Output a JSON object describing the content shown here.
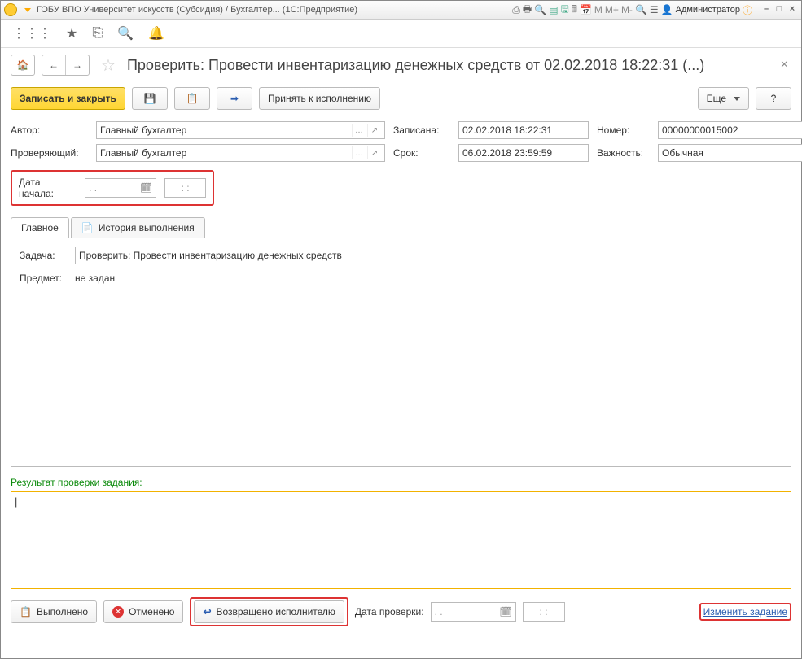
{
  "titlebar": {
    "text": "ГОБУ ВПО Университет искусств (Субсидия) / Бухгалтер... (1С:Предприятие)",
    "user": "Администратор"
  },
  "toolbar_extras": [
    "M",
    "M+",
    "M-"
  ],
  "page": {
    "title": "Проверить: Провести инвентаризацию денежных средств от 02.02.2018 18:22:31 (...)"
  },
  "cmd": {
    "write_close": "Записать и закрыть",
    "accept": "Принять к исполнению",
    "more": "Еще",
    "help": "?"
  },
  "form": {
    "author_label": "Автор:",
    "author_value": "Главный бухгалтер",
    "recorded_label": "Записана:",
    "recorded_value": "02.02.2018 18:22:31",
    "number_label": "Номер:",
    "number_value": "00000000015002",
    "checker_label": "Проверяющий:",
    "checker_value": "Главный бухгалтер",
    "deadline_label": "Срок:",
    "deadline_value": "06.02.2018 23:59:59",
    "importance_label": "Важность:",
    "importance_value": "Обычная",
    "startdate_label": "Дата начала:",
    "startdate_date": ".  .",
    "startdate_time": ":  :"
  },
  "tabs": {
    "main": "Главное",
    "history": "История выполнения"
  },
  "tabbody": {
    "task_label": "Задача:",
    "task_value": "Проверить: Провести инвентаризацию денежных средств",
    "subject_label": "Предмет:",
    "subject_value": "не задан"
  },
  "result": {
    "label": "Результат проверки задания:",
    "text": ""
  },
  "bottom": {
    "done": "Выполнено",
    "cancelled": "Отменено",
    "returned": "Возвращено исполнителю",
    "checkdate_label": "Дата проверки:",
    "checkdate_date": ".  .",
    "checkdate_time": ":  :",
    "change_task": "Изменить задание"
  }
}
